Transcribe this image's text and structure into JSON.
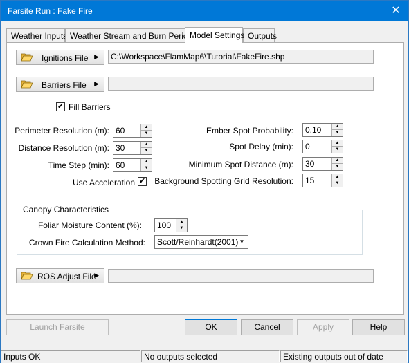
{
  "window": {
    "title": "Farsite Run : Fake Fire"
  },
  "tabs": [
    "Weather Inputs",
    "Weather Stream and Burn Periods",
    "Model Settings",
    "Outputs"
  ],
  "active_tab": "Model Settings",
  "files": {
    "ignitions_label": "Ignitions File",
    "ignitions_path": "C:\\Workspace\\FlamMap6\\Tutorial\\FakeFire.shp",
    "barriers_label": "Barriers File",
    "barriers_path": "",
    "ros_label": "ROS Adjust File",
    "ros_path": ""
  },
  "fill_barriers": {
    "label": "Fill Barriers",
    "checked": true
  },
  "left_settings": {
    "perimeter_resolution": {
      "label": "Perimeter Resolution (m):",
      "value": "60"
    },
    "distance_resolution": {
      "label": "Distance Resolution (m):",
      "value": "30"
    },
    "time_step": {
      "label": "Time Step (min):",
      "value": "60"
    },
    "use_acceleration": {
      "label": "Use Acceleration",
      "checked": true
    }
  },
  "right_settings": {
    "ember_spot_probability": {
      "label": "Ember Spot Probability:",
      "value": "0.10"
    },
    "spot_delay": {
      "label": "Spot Delay (min):",
      "value": "0"
    },
    "minimum_spot_distance": {
      "label": "Minimum Spot Distance (m):",
      "value": "30"
    },
    "background_spotting_grid": {
      "label": "Background Spotting Grid Resolution:",
      "value": "15"
    }
  },
  "canopy": {
    "title": "Canopy Characteristics",
    "foliar_moisture_label": "Foliar Moisture Content (%):",
    "foliar_moisture_value": "100",
    "crown_fire_label": "Crown Fire Calculation Method:",
    "crown_fire_value": "Scott/Reinhardt(2001)"
  },
  "buttons": {
    "launch": "Launch Farsite",
    "ok": "OK",
    "cancel": "Cancel",
    "apply": "Apply",
    "help": "Help"
  },
  "status": {
    "inputs": "Inputs OK",
    "outputs": "No outputs selected",
    "existing": "Existing outputs out of date"
  },
  "icons": {
    "close": "close-icon",
    "folder": "folder-open-icon",
    "arrow": "triangle-right-icon",
    "check": "checkmark-icon",
    "spin_up": "triangle-up-icon",
    "spin_down": "triangle-down-icon",
    "dropdown": "chevron-down-icon"
  },
  "colors": {
    "titlebar": "#0078d7",
    "accent": "#0078d7",
    "folder_fill": "#ffd86a"
  }
}
